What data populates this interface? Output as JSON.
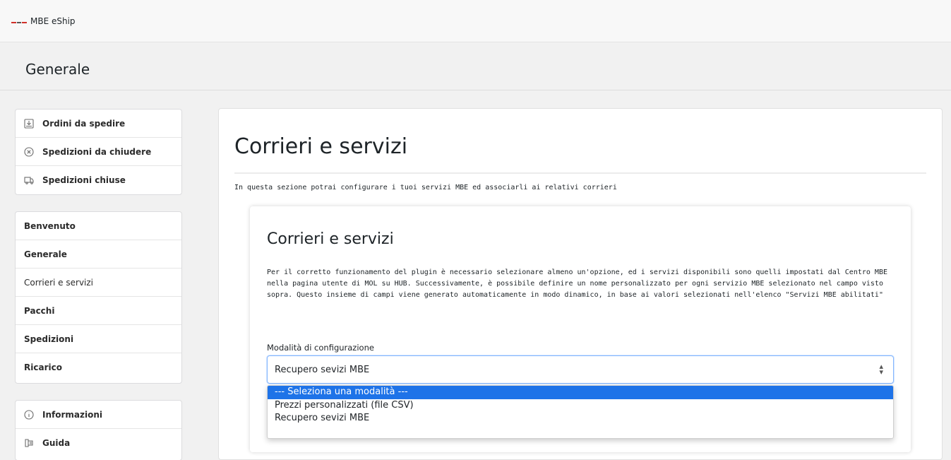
{
  "topbar": {
    "app_name": "MBE eShip",
    "logo": "mbe-logo-icon"
  },
  "page_header": {
    "title": "Generale"
  },
  "sidebar": {
    "group1": [
      {
        "label": "Ordini da spedire",
        "icon": "download-box-icon"
      },
      {
        "label": "Spedizioni da chiudere",
        "icon": "circle-x-icon"
      },
      {
        "label": "Spedizioni chiuse",
        "icon": "truck-icon"
      }
    ],
    "group2": [
      {
        "label": "Benvenuto"
      },
      {
        "label": "Generale"
      },
      {
        "label": "Corrieri e servizi"
      },
      {
        "label": "Pacchi"
      },
      {
        "label": "Spedizioni"
      },
      {
        "label": "Ricarico"
      }
    ],
    "group3": [
      {
        "label": "Informazioni",
        "icon": "info-circle-icon"
      },
      {
        "label": "Guida",
        "icon": "guide-icon"
      }
    ]
  },
  "main": {
    "title": "Corrieri e servizi",
    "description": "In questa sezione potrai configurare i tuoi servizi MBE ed associarli ai relativi corrieri",
    "card": {
      "title": "Corrieri e servizi",
      "description": "Per il corretto funzionamento del plugin è necessario selezionare almeno un'opzione, ed i servizi disponibili sono quelli impostati dal Centro MBE nella pagina utente di MOL su HUB. Successivamente, è possibile definire un nome personalizzato per ogni servizio MBE selezionato nel campo visto sopra. Questo insieme di campi viene generato automaticamente in modo dinamico, in base ai valori selezionati nell'elenco \"Servizi MBE abilitati\"",
      "select_label": "Modalità di configurazione",
      "select_value": "Recupero sevizi MBE",
      "options": [
        "--- Seleziona una modalità ---",
        "Prezzi personalizzati (file CSV)",
        "Recupero sevizi MBE"
      ],
      "highlighted_option": "--- Seleziona una modalità ---"
    }
  },
  "colors": {
    "accent": "#1e73e8",
    "focus_border": "#86b7fe",
    "logo_red": "#d0302a"
  }
}
